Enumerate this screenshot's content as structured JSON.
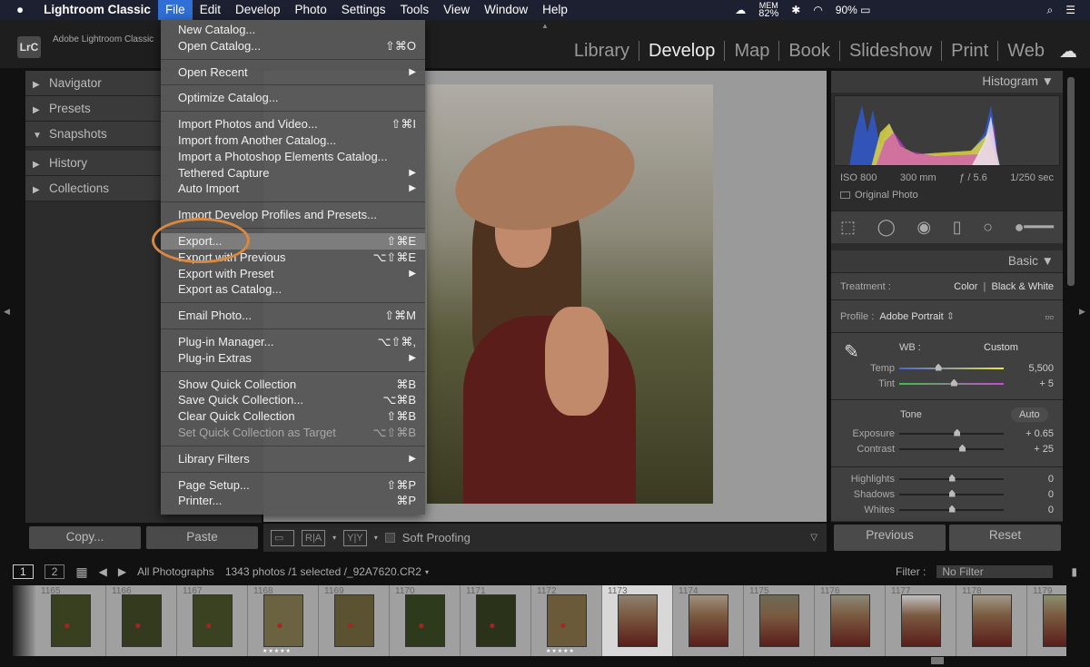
{
  "menubar": {
    "apple": "",
    "app": "Lightroom Classic",
    "items": [
      "File",
      "Edit",
      "Develop",
      "Photo",
      "Settings",
      "Tools",
      "View",
      "Window",
      "Help"
    ],
    "mem_label": "MEM",
    "mem_value": "82%",
    "battery": "90%"
  },
  "header": {
    "logo": "LrC",
    "brand": "Adobe Lightroom Classic",
    "modules": [
      "Library",
      "Develop",
      "Map",
      "Book",
      "Slideshow",
      "Print",
      "Web"
    ],
    "active_module": "Develop"
  },
  "left_panel": {
    "sections": [
      {
        "label": "Navigator",
        "open": false
      },
      {
        "label": "Presets",
        "open": false
      },
      {
        "label": "Snapshots",
        "open": true
      },
      {
        "label": "History",
        "open": false
      },
      {
        "label": "Collections",
        "open": false
      }
    ],
    "copy": "Copy...",
    "paste": "Paste"
  },
  "toolbar": {
    "soft_proofing": "Soft Proofing",
    "ra": "R|A",
    "yy": "Y|Y"
  },
  "right_panel": {
    "histogram": "Histogram",
    "iso": "ISO 800",
    "focal": "300 mm",
    "aperture": "ƒ / 5.6",
    "shutter": "1/250 sec",
    "original_photo": "Original Photo",
    "basic": "Basic",
    "treatment_label": "Treatment :",
    "treatment_color": "Color",
    "treatment_bw": "Black & White",
    "profile_label": "Profile :",
    "profile_value": "Adobe Portrait",
    "wb_label": "WB :",
    "wb_value": "Custom",
    "tone": "Tone",
    "auto": "Auto",
    "sliders": [
      {
        "label": "Temp",
        "value": "5,500",
        "pos": 0.37
      },
      {
        "label": "Tint",
        "value": "+ 5",
        "pos": 0.52
      },
      {
        "label": "Exposure",
        "value": "+ 0.65",
        "pos": 0.55
      },
      {
        "label": "Contrast",
        "value": "+ 25",
        "pos": 0.6
      },
      {
        "label": "Highlights",
        "value": "0",
        "pos": 0.5
      },
      {
        "label": "Shadows",
        "value": "0",
        "pos": 0.5
      },
      {
        "label": "Whites",
        "value": "0",
        "pos": 0.5
      }
    ],
    "previous": "Previous",
    "reset": "Reset"
  },
  "filmstrip_bar": {
    "view1": "1",
    "view2": "2",
    "source": "All Photographs",
    "count": "1343 photos /1 selected /_92A7620.CR2",
    "filter_label": "Filter :",
    "filter_value": "No Filter"
  },
  "filmstrip": [
    {
      "n": "1165"
    },
    {
      "n": "1166"
    },
    {
      "n": "1167"
    },
    {
      "n": "1168",
      "stars": "★★★★★"
    },
    {
      "n": "1169"
    },
    {
      "n": "1170"
    },
    {
      "n": "1171"
    },
    {
      "n": "1172",
      "stars": "★★★★★"
    },
    {
      "n": "1173",
      "selected": true
    },
    {
      "n": "1174"
    },
    {
      "n": "1175"
    },
    {
      "n": "1176"
    },
    {
      "n": "1177"
    },
    {
      "n": "1178"
    },
    {
      "n": "1179"
    }
  ],
  "file_menu": [
    [
      {
        "label": "New Catalog..."
      },
      {
        "label": "Open Catalog...",
        "shortcut": "⇧⌘O"
      }
    ],
    [
      {
        "label": "Open Recent",
        "submenu": true
      }
    ],
    [
      {
        "label": "Optimize Catalog..."
      }
    ],
    [
      {
        "label": "Import Photos and Video...",
        "shortcut": "⇧⌘I"
      },
      {
        "label": "Import from Another Catalog..."
      },
      {
        "label": "Import a Photoshop Elements Catalog..."
      },
      {
        "label": "Tethered Capture",
        "submenu": true
      },
      {
        "label": "Auto Import",
        "submenu": true
      }
    ],
    [
      {
        "label": "Import Develop Profiles and Presets..."
      }
    ],
    [
      {
        "label": "Export...",
        "shortcut": "⇧⌘E",
        "highlighted": true
      },
      {
        "label": "Export with Previous",
        "shortcut": "⌥⇧⌘E"
      },
      {
        "label": "Export with Preset",
        "submenu": true
      },
      {
        "label": "Export as Catalog..."
      }
    ],
    [
      {
        "label": "Email Photo...",
        "shortcut": "⇧⌘M"
      }
    ],
    [
      {
        "label": "Plug-in Manager...",
        "shortcut": "⌥⇧⌘,"
      },
      {
        "label": "Plug-in Extras",
        "submenu": true
      }
    ],
    [
      {
        "label": "Show Quick Collection",
        "shortcut": "⌘B"
      },
      {
        "label": "Save Quick Collection...",
        "shortcut": "⌥⌘B"
      },
      {
        "label": "Clear Quick Collection",
        "shortcut": "⇧⌘B"
      },
      {
        "label": "Set Quick Collection as Target",
        "shortcut": "⌥⇧⌘B",
        "disabled": true
      }
    ],
    [
      {
        "label": "Library Filters",
        "submenu": true
      }
    ],
    [
      {
        "label": "Page Setup...",
        "shortcut": "⇧⌘P"
      },
      {
        "label": "Printer...",
        "shortcut": "⌘P"
      }
    ]
  ],
  "annotation_color": "#d9883f"
}
